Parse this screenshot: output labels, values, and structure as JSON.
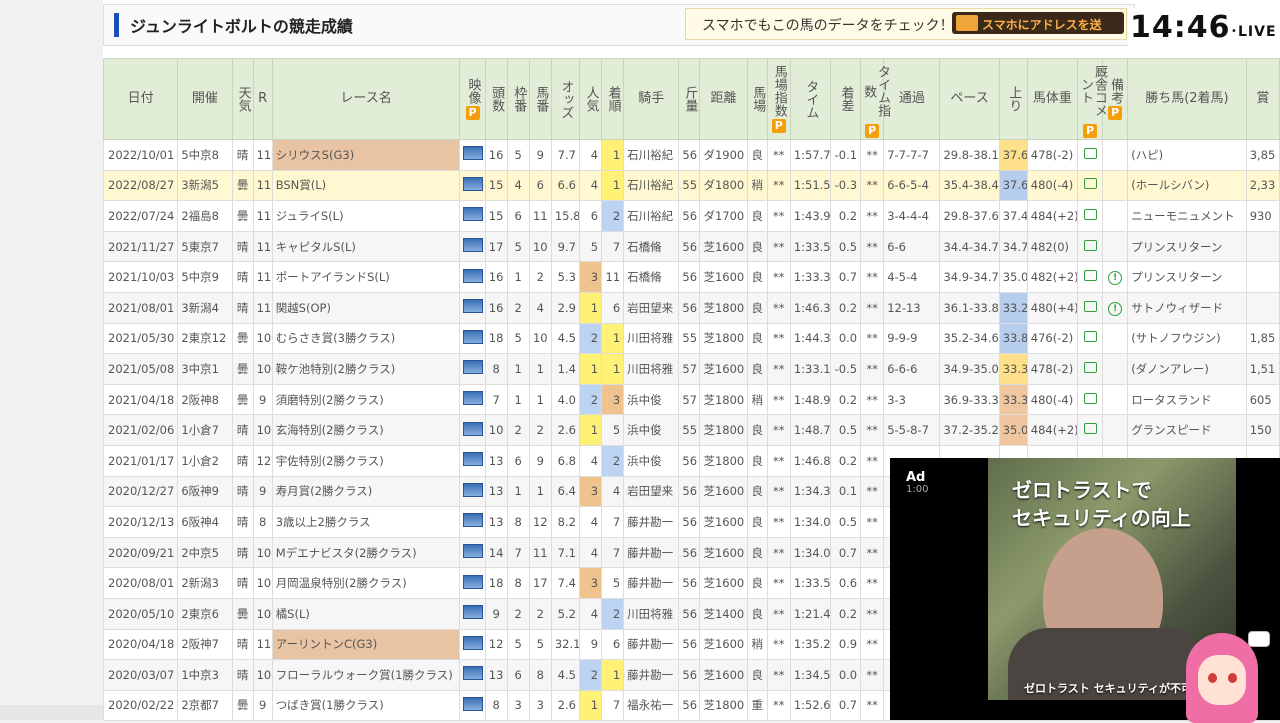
{
  "header": {
    "title": "ジュンライトボルトの競走成績",
    "promo_text": "スマホでもこの馬のデータをチェック！",
    "promo_button": "スマホにアドレスを送"
  },
  "stream": {
    "time": "14:46",
    "live": "LIVE"
  },
  "columns": [
    "日付",
    "開催",
    "天気",
    "R",
    "レース名",
    "映像",
    "頭数",
    "枠番",
    "馬番",
    "オッズ",
    "人気",
    "着順",
    "騎手",
    "斤量",
    "距離",
    "馬場",
    "馬場指数",
    "タイム",
    "着差",
    "タイム指数",
    "通過",
    "ペース",
    "上り",
    "馬体重",
    "厩舎コメント",
    "備考",
    "勝ち馬(2着馬)",
    "賞"
  ],
  "premium_badge": "P",
  "rows": [
    {
      "date": "2022/10/01",
      "venue": "5中京8",
      "weather": "晴",
      "r": "11",
      "race": "シリウスS(G3)",
      "heads": "16",
      "waku": "5",
      "uma": "9",
      "odds": "7.7",
      "pop": "4",
      "rank": "1",
      "jockey": "石川裕紀",
      "kin": "56",
      "dist": "ダ1900",
      "baba": "良",
      "idx": "**",
      "time": "1:57.7",
      "diff": "-0.1",
      "tidx": "**",
      "pass": "7-7-7-7",
      "pace": "29.8-38.1",
      "agari": "37.6",
      "weight": "478(-2)",
      "note": "",
      "winner": "(ハピ)",
      "prize": "3,85"
    },
    {
      "date": "2022/08/27",
      "venue": "3新潟5",
      "weather": "曇",
      "r": "11",
      "race": "BSN賞(L)",
      "heads": "15",
      "waku": "4",
      "uma": "6",
      "odds": "6.6",
      "pop": "4",
      "rank": "1",
      "jockey": "石川裕紀",
      "kin": "55",
      "dist": "ダ1800",
      "baba": "稍",
      "idx": "**",
      "time": "1:51.5",
      "diff": "-0.3",
      "tidx": "**",
      "pass": "6-6-5-4",
      "pace": "35.4-38.4",
      "agari": "37.6",
      "weight": "480(-4)",
      "note": "",
      "winner": "(ホールシバン)",
      "prize": "2,33"
    },
    {
      "date": "2022/07/24",
      "venue": "2福島8",
      "weather": "曇",
      "r": "11",
      "race": "ジュライS(L)",
      "heads": "15",
      "waku": "6",
      "uma": "11",
      "odds": "15.8",
      "pop": "6",
      "rank": "2",
      "jockey": "石川裕紀",
      "kin": "56",
      "dist": "ダ1700",
      "baba": "良",
      "idx": "**",
      "time": "1:43.9",
      "diff": "0.2",
      "tidx": "**",
      "pass": "3-4-4-4",
      "pace": "29.8-37.6",
      "agari": "37.4",
      "weight": "484(+2)",
      "note": "",
      "winner": "ニューモニュメント",
      "prize": "930"
    },
    {
      "date": "2021/11/27",
      "venue": "5東京7",
      "weather": "晴",
      "r": "11",
      "race": "キャピタルS(L)",
      "heads": "17",
      "waku": "5",
      "uma": "10",
      "odds": "9.7",
      "pop": "5",
      "rank": "7",
      "jockey": "石橋脩",
      "kin": "56",
      "dist": "芝1600",
      "baba": "良",
      "idx": "**",
      "time": "1:33.5",
      "diff": "0.5",
      "tidx": "**",
      "pass": "6-6",
      "pace": "34.4-34.7",
      "agari": "34.7",
      "weight": "482(0)",
      "note": "",
      "winner": "プリンスリターン",
      "prize": ""
    },
    {
      "date": "2021/10/03",
      "venue": "5中京9",
      "weather": "晴",
      "r": "11",
      "race": "ポートアイランドS(L)",
      "heads": "16",
      "waku": "1",
      "uma": "2",
      "odds": "5.3",
      "pop": "3",
      "rank": "11",
      "jockey": "石橋脩",
      "kin": "56",
      "dist": "芝1600",
      "baba": "良",
      "idx": "**",
      "time": "1:33.3",
      "diff": "0.7",
      "tidx": "**",
      "pass": "4-5-4",
      "pace": "34.9-34.7",
      "agari": "35.0",
      "weight": "482(+2)",
      "note": "!",
      "winner": "プリンスリターン",
      "prize": ""
    },
    {
      "date": "2021/08/01",
      "venue": "3新潟4",
      "weather": "晴",
      "r": "11",
      "race": "関越S(OP)",
      "heads": "16",
      "waku": "2",
      "uma": "4",
      "odds": "2.9",
      "pop": "1",
      "rank": "6",
      "jockey": "岩田望来",
      "kin": "56",
      "dist": "芝1800",
      "baba": "良",
      "idx": "**",
      "time": "1:46.3",
      "diff": "0.2",
      "tidx": "**",
      "pass": "12-13",
      "pace": "36.1-33.8",
      "agari": "33.2",
      "weight": "480(+4)",
      "note": "!",
      "winner": "サトノウィザード",
      "prize": ""
    },
    {
      "date": "2021/05/30",
      "venue": "2東京12",
      "weather": "曇",
      "r": "10",
      "race": "むらさき賞(3勝クラス)",
      "heads": "18",
      "waku": "5",
      "uma": "10",
      "odds": "4.5",
      "pop": "2",
      "rank": "1",
      "jockey": "川田将雅",
      "kin": "55",
      "dist": "芝1800",
      "baba": "良",
      "idx": "**",
      "time": "1:44.3",
      "diff": "0.0",
      "tidx": "**",
      "pass": "9-9-9",
      "pace": "35.2-34.6",
      "agari": "33.8",
      "weight": "476(-2)",
      "note": "",
      "winner": "(サトノフウジン)",
      "prize": "1,85"
    },
    {
      "date": "2021/05/08",
      "venue": "3中京1",
      "weather": "曇",
      "r": "10",
      "race": "鞍ケ池特別(2勝クラス)",
      "heads": "8",
      "waku": "1",
      "uma": "1",
      "odds": "1.4",
      "pop": "1",
      "rank": "1",
      "jockey": "川田将雅",
      "kin": "57",
      "dist": "芝1600",
      "baba": "良",
      "idx": "**",
      "time": "1:33.1",
      "diff": "-0.5",
      "tidx": "**",
      "pass": "6-6-6",
      "pace": "34.9-35.0",
      "agari": "33.3",
      "weight": "478(-2)",
      "note": "",
      "winner": "(ダノンアレー)",
      "prize": "1,51"
    },
    {
      "date": "2021/04/18",
      "venue": "2阪神8",
      "weather": "曇",
      "r": "9",
      "race": "須磨特別(2勝クラス)",
      "heads": "7",
      "waku": "1",
      "uma": "1",
      "odds": "4.0",
      "pop": "2",
      "rank": "3",
      "jockey": "浜中俊",
      "kin": "57",
      "dist": "芝1800",
      "baba": "稍",
      "idx": "**",
      "time": "1:48.9",
      "diff": "0.2",
      "tidx": "**",
      "pass": "3-3",
      "pace": "36.9-33.3",
      "agari": "33.3",
      "weight": "480(-4)",
      "note": "",
      "winner": "ロータスランド",
      "prize": "605"
    },
    {
      "date": "2021/02/06",
      "venue": "1小倉7",
      "weather": "晴",
      "r": "10",
      "race": "玄海特別(2勝クラス)",
      "heads": "10",
      "waku": "2",
      "uma": "2",
      "odds": "2.6",
      "pop": "1",
      "rank": "5",
      "jockey": "浜中俊",
      "kin": "55",
      "dist": "芝1800",
      "baba": "良",
      "idx": "**",
      "time": "1:48.7",
      "diff": "0.5",
      "tidx": "**",
      "pass": "5-5-8-7",
      "pace": "37.2-35.2",
      "agari": "35.0",
      "weight": "484(+2)",
      "note": "",
      "winner": "グランスピード",
      "prize": "150"
    },
    {
      "date": "2021/01/17",
      "venue": "1小倉2",
      "weather": "晴",
      "r": "12",
      "race": "宇佐特別(2勝クラス)",
      "heads": "13",
      "waku": "6",
      "uma": "9",
      "odds": "6.8",
      "pop": "4",
      "rank": "2",
      "jockey": "浜中俊",
      "kin": "56",
      "dist": "芝1800",
      "baba": "良",
      "idx": "**",
      "time": "1:46.8",
      "diff": "0.2",
      "tidx": "**",
      "pass": "",
      "pace": "",
      "agari": "",
      "weight": "",
      "note": "",
      "winner": "",
      "prize": ""
    },
    {
      "date": "2020/12/27",
      "venue": "6阪神9",
      "weather": "晴",
      "r": "9",
      "race": "寿月賞(2勝クラス)",
      "heads": "13",
      "waku": "1",
      "uma": "1",
      "odds": "6.4",
      "pop": "3",
      "rank": "4",
      "jockey": "岩田望来",
      "kin": "56",
      "dist": "芝1600",
      "baba": "良",
      "idx": "**",
      "time": "1:34.3",
      "diff": "0.1",
      "tidx": "**",
      "pass": "",
      "pace": "",
      "agari": "",
      "weight": "",
      "note": "",
      "winner": "",
      "prize": ""
    },
    {
      "date": "2020/12/13",
      "venue": "6阪神4",
      "weather": "晴",
      "r": "8",
      "race": "3歳以上2勝クラス",
      "heads": "13",
      "waku": "8",
      "uma": "12",
      "odds": "8.2",
      "pop": "4",
      "rank": "7",
      "jockey": "藤井勘一",
      "kin": "56",
      "dist": "芝1600",
      "baba": "良",
      "idx": "**",
      "time": "1:34.0",
      "diff": "0.5",
      "tidx": "**",
      "pass": "",
      "pace": "",
      "agari": "",
      "weight": "",
      "note": "",
      "winner": "",
      "prize": ""
    },
    {
      "date": "2020/09/21",
      "venue": "2中京5",
      "weather": "晴",
      "r": "10",
      "race": "Mデエナビスタ(2勝クラス)",
      "heads": "14",
      "waku": "7",
      "uma": "11",
      "odds": "7.1",
      "pop": "4",
      "rank": "7",
      "jockey": "藤井勘一",
      "kin": "56",
      "dist": "芝1600",
      "baba": "良",
      "idx": "**",
      "time": "1:34.0",
      "diff": "0.7",
      "tidx": "**",
      "pass": "",
      "pace": "",
      "agari": "",
      "weight": "",
      "note": "",
      "winner": "",
      "prize": ""
    },
    {
      "date": "2020/08/01",
      "venue": "2新潟3",
      "weather": "晴",
      "r": "10",
      "race": "月岡温泉特別(2勝クラス)",
      "heads": "18",
      "waku": "8",
      "uma": "17",
      "odds": "7.4",
      "pop": "3",
      "rank": "5",
      "jockey": "藤井勘一",
      "kin": "56",
      "dist": "芝1600",
      "baba": "良",
      "idx": "**",
      "time": "1:33.5",
      "diff": "0.6",
      "tidx": "**",
      "pass": "",
      "pace": "",
      "agari": "",
      "weight": "",
      "note": "",
      "winner": "",
      "prize": ""
    },
    {
      "date": "2020/05/10",
      "venue": "2東京6",
      "weather": "曇",
      "r": "10",
      "race": "橘S(L)",
      "heads": "9",
      "waku": "2",
      "uma": "2",
      "odds": "5.2",
      "pop": "4",
      "rank": "2",
      "jockey": "川田将雅",
      "kin": "56",
      "dist": "芝1400",
      "baba": "良",
      "idx": "**",
      "time": "1:21.4",
      "diff": "0.2",
      "tidx": "**",
      "pass": "",
      "pace": "",
      "agari": "",
      "weight": "",
      "note": "",
      "winner": "",
      "prize": ""
    },
    {
      "date": "2020/04/18",
      "venue": "2阪神7",
      "weather": "晴",
      "r": "11",
      "race": "アーリントンC(G3)",
      "heads": "12",
      "waku": "5",
      "uma": "5",
      "odds": "32.1",
      "pop": "9",
      "rank": "6",
      "jockey": "藤井勘一",
      "kin": "56",
      "dist": "芝1600",
      "baba": "稍",
      "idx": "**",
      "time": "1:35.2",
      "diff": "0.9",
      "tidx": "**",
      "pass": "",
      "pace": "",
      "agari": "",
      "weight": "",
      "note": "",
      "winner": "",
      "prize": ""
    },
    {
      "date": "2020/03/07",
      "venue": "1中京3",
      "weather": "晴",
      "r": "10",
      "race": "フローラルウォーク賞(1勝クラス)",
      "heads": "13",
      "waku": "6",
      "uma": "8",
      "odds": "4.5",
      "pop": "2",
      "rank": "1",
      "jockey": "藤井勘一",
      "kin": "56",
      "dist": "芝1600",
      "baba": "良",
      "idx": "**",
      "time": "1:34.5",
      "diff": "0.0",
      "tidx": "**",
      "pass": "",
      "pace": "",
      "agari": "",
      "weight": "",
      "note": "",
      "winner": "",
      "prize": ""
    },
    {
      "date": "2020/02/22",
      "venue": "2京都7",
      "weather": "曇",
      "r": "9",
      "race": "つばき賞(1勝クラス)",
      "heads": "8",
      "waku": "3",
      "uma": "3",
      "odds": "2.6",
      "pop": "1",
      "rank": "7",
      "jockey": "福永祐一",
      "kin": "56",
      "dist": "芝1800",
      "baba": "重",
      "idx": "**",
      "time": "1:52.6",
      "diff": "0.7",
      "tidx": "**",
      "pass": "",
      "pace": "",
      "agari": "",
      "weight": "",
      "note": "",
      "winner": "",
      "prize": ""
    }
  ],
  "ad": {
    "label": "Ad",
    "countdown": "1:00",
    "headline": "ゼロトラストで\nセキュリティの向上",
    "caption": "ゼロトラスト セキュリティが不可"
  }
}
